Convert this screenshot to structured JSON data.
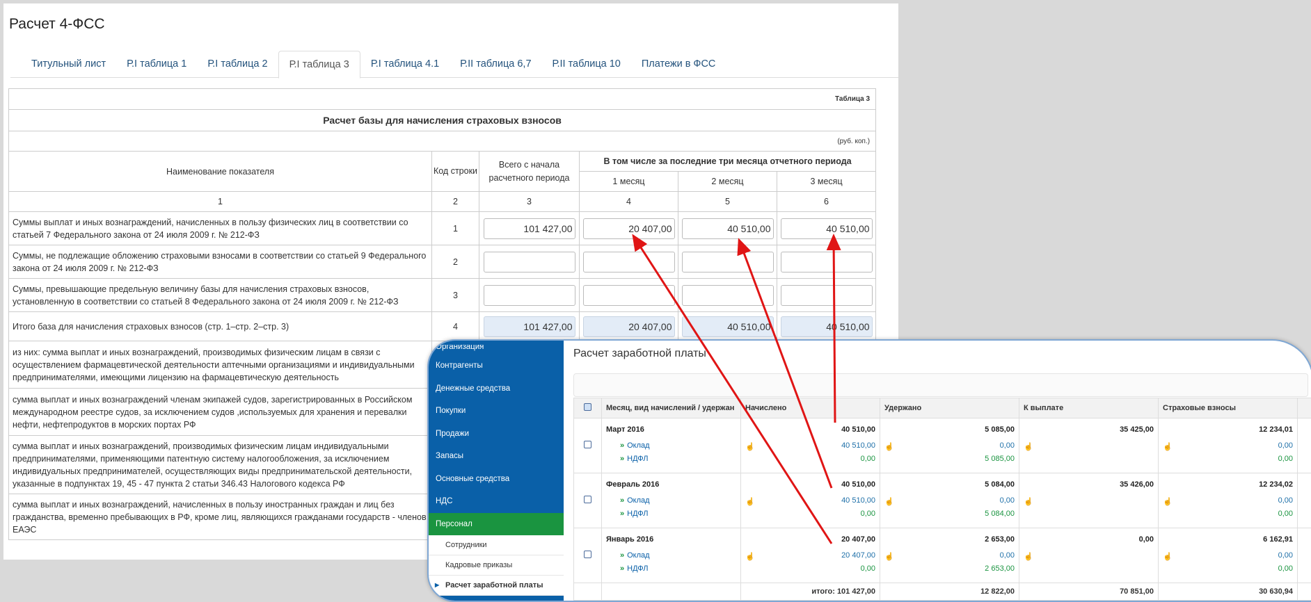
{
  "form": {
    "title": "Расчет 4-ФСС",
    "tabs": [
      {
        "label": "Титульный лист"
      },
      {
        "label": "Р.I таблица 1"
      },
      {
        "label": "Р.I таблица 2"
      },
      {
        "label": "Р.I таблица 3",
        "active": true
      },
      {
        "label": "Р.I таблица 4.1"
      },
      {
        "label": "Р.II таблица 6,7"
      },
      {
        "label": "Р.II таблица 10"
      },
      {
        "label": "Платежи в ФСС"
      }
    ],
    "table_label": "Таблица 3",
    "table_title": "Расчет базы для начисления страховых взносов",
    "units": "(руб. коп.)",
    "headers": {
      "name": "Наименование показателя",
      "code": "Код строки",
      "total": "Всего с начала расчетного периода",
      "last3": "В том числе за последние три месяца отчетного периода",
      "m1": "1 месяц",
      "m2": "2 месяц",
      "m3": "3 месяц"
    },
    "colnums": [
      "1",
      "2",
      "3",
      "4",
      "5",
      "6"
    ],
    "rows": [
      {
        "label": "Суммы выплат и иных вознаграждений, начисленных в пользу физических лиц в соответствии со статьей 7 Федерального закона от 24 июля 2009 г. № 212-ФЗ",
        "code": "1",
        "total": "101 427,00",
        "m1": "20 407,00",
        "m2": "40 510,00",
        "m3": "40 510,00"
      },
      {
        "label": "Суммы, не подлежащие обложению страховыми взносами в соответствии со статьей 9 Федерального закона от 24 июля 2009 г. № 212-ФЗ",
        "code": "2",
        "total": "",
        "m1": "",
        "m2": "",
        "m3": ""
      },
      {
        "label": "Суммы, превышающие предельную величину базы для начисления страховых взносов, установленную в соответствии со статьей 8 Федерального закона от 24 июля 2009 г. № 212-ФЗ",
        "code": "3",
        "total": "",
        "m1": "",
        "m2": "",
        "m3": ""
      },
      {
        "label": "Итого база для начисления страховых взносов (стр. 1–стр. 2–стр. 3)",
        "code": "4",
        "total": "101 427,00",
        "m1": "20 407,00",
        "m2": "40 510,00",
        "m3": "40 510,00"
      },
      {
        "label": "из них: сумма выплат и иных вознаграждений, производимых физическим лицам в связи с осуществлением фармацевтической деятельности аптечными организациями и индивидуальными предпринимателями, имеющими лицензию на фармацевтическую деятельность"
      },
      {
        "label": "сумма выплат и иных вознаграждений членам экипажей судов, зарегистрированных в Российском международном реестре судов, за исключением судов ,используемых для хранения и перевалки нефти, нефтепродуктов в морских портах РФ"
      },
      {
        "label": "сумма выплат и иных вознаграждений, производимых физическим лицам индивидуальными предпринимателями, применяющими патентную систему налогообложения, за исключением индивидуальных предпринимателей, осуществляющих виды предпринимательской деятельности, указанные в подпунктах 19, 45 - 47 пункта 2 статьи 346.43 Налогового кодекса РФ"
      },
      {
        "label": "сумма выплат и иных вознаграждений, начисленных в пользу иностранных граждан и лиц без гражданства, временно пребывающих в РФ, кроме лиц, являющихся гражданами государств - членов ЕАЭС"
      }
    ]
  },
  "payroll": {
    "title": "Расчет заработной платы",
    "sidebar": [
      {
        "label": "Организация"
      },
      {
        "label": "Контрагенты"
      },
      {
        "label": "Денежные средства"
      },
      {
        "label": "Покупки"
      },
      {
        "label": "Продажи"
      },
      {
        "label": "Запасы"
      },
      {
        "label": "Основные средства"
      },
      {
        "label": "НДС"
      },
      {
        "label": "Персонал",
        "active": true
      }
    ],
    "submenu": [
      {
        "label": "Сотрудники"
      },
      {
        "label": "Кадровые приказы"
      },
      {
        "label": "Расчет заработной платы",
        "current": true
      }
    ],
    "columns": [
      "Месяц, вид начислений / удержан",
      "Начислено",
      "Удержано",
      "К выплате",
      "Страховые взносы"
    ],
    "months": [
      {
        "name": "Март 2016",
        "items": [
          "Оклад",
          "НДФЛ"
        ],
        "accrued": [
          "40 510,00",
          "40 510,00",
          "0,00"
        ],
        "withheld": [
          "5 085,00",
          "0,00",
          "5 085,00"
        ],
        "payable": "35 425,00",
        "insurance": [
          "12 234,01",
          "0,00",
          "0,00"
        ]
      },
      {
        "name": "Февраль 2016",
        "items": [
          "Оклад",
          "НДФЛ"
        ],
        "accrued": [
          "40 510,00",
          "40 510,00",
          "0,00"
        ],
        "withheld": [
          "5 084,00",
          "0,00",
          "5 084,00"
        ],
        "payable": "35 426,00",
        "insurance": [
          "12 234,02",
          "0,00",
          "0,00"
        ]
      },
      {
        "name": "Январь 2016",
        "items": [
          "Оклад",
          "НДФЛ"
        ],
        "accrued": [
          "20 407,00",
          "20 407,00",
          "0,00"
        ],
        "withheld": [
          "2 653,00",
          "0,00",
          "2 653,00"
        ],
        "payable": "0,00",
        "insurance": [
          "6 162,91",
          "0,00",
          "0,00"
        ]
      }
    ],
    "totals": {
      "accrued": "итого: 101 427,00",
      "withheld": "12 822,00",
      "payable": "70 851,00",
      "insurance": "30 630,94"
    }
  },
  "colors": {
    "link": "#23527c",
    "sidebar": "#0a60a8",
    "sidebar_active": "#1a9440",
    "arrow": "#e01515",
    "calc_cell": "#e3ecf7"
  }
}
